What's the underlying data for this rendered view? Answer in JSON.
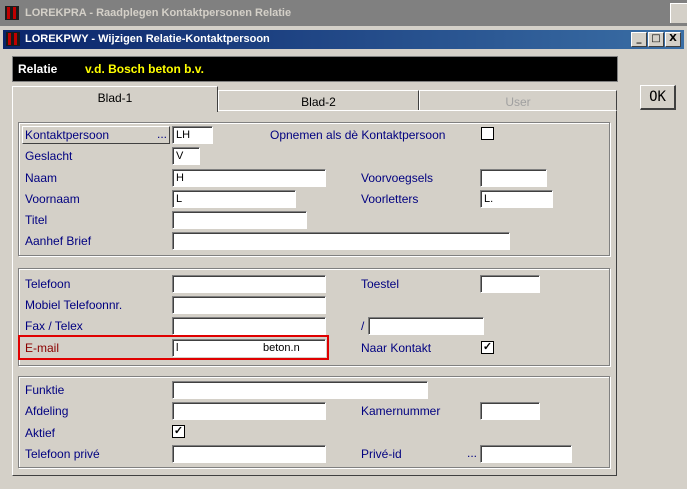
{
  "outer_window": {
    "title": "LOREKPRA - Raadplegen Kontaktpersonen Relatie"
  },
  "inner_window": {
    "title": "LOREKPWY - Wijzigen Relatie-Kontaktpersoon",
    "minimize": "_",
    "maximize": "□",
    "close": "X"
  },
  "relatie": {
    "label": "Relatie",
    "value": "v.d. Bosch beton b.v."
  },
  "ok_label": "OK",
  "tabs": [
    {
      "label": "Blad-1"
    },
    {
      "label": "Blad-2"
    },
    {
      "label": "User"
    }
  ],
  "group1": {
    "kontaktpersoon": {
      "label": "Kontaktpersoon",
      "dots": "...",
      "value": "LH"
    },
    "opnemen": {
      "label": "Opnemen als dè Kontaktpersoon",
      "checked": ""
    },
    "geslacht": {
      "label": "Geslacht",
      "value": "V"
    },
    "naam": {
      "label": "Naam",
      "value": "H"
    },
    "voorvoegsels": {
      "label": "Voorvoegsels",
      "value": ""
    },
    "voornaam": {
      "label": "Voornaam",
      "value": "L"
    },
    "voorletters": {
      "label": "Voorletters",
      "value": "L."
    },
    "titel": {
      "label": "Titel",
      "value": ""
    },
    "aanhef": {
      "label": "Aanhef Brief",
      "value": ""
    }
  },
  "group2": {
    "telefoon": {
      "label": "Telefoon",
      "value": ""
    },
    "toestel": {
      "label": "Toestel",
      "value": ""
    },
    "mobiel": {
      "label": "Mobiel Telefoonnr.",
      "value": ""
    },
    "fax": {
      "label": "Fax / Telex",
      "value": "",
      "slash": "/",
      "value2": ""
    },
    "email": {
      "label": "E-mail",
      "value_start": "l",
      "value_end": "beton.n"
    },
    "naar_kontakt": {
      "label": "Naar Kontakt",
      "checked": "✓"
    }
  },
  "group3": {
    "funktie": {
      "label": "Funktie",
      "value": ""
    },
    "afdeling": {
      "label": "Afdeling",
      "value": ""
    },
    "kamernummer": {
      "label": "Kamernummer",
      "value": ""
    },
    "aktief": {
      "label": "Aktief",
      "checked": "✓"
    },
    "telefoon_prive": {
      "label": "Telefoon privé",
      "value": ""
    },
    "prive_id": {
      "label": "Privé-id",
      "dots": "...",
      "value": ""
    }
  }
}
